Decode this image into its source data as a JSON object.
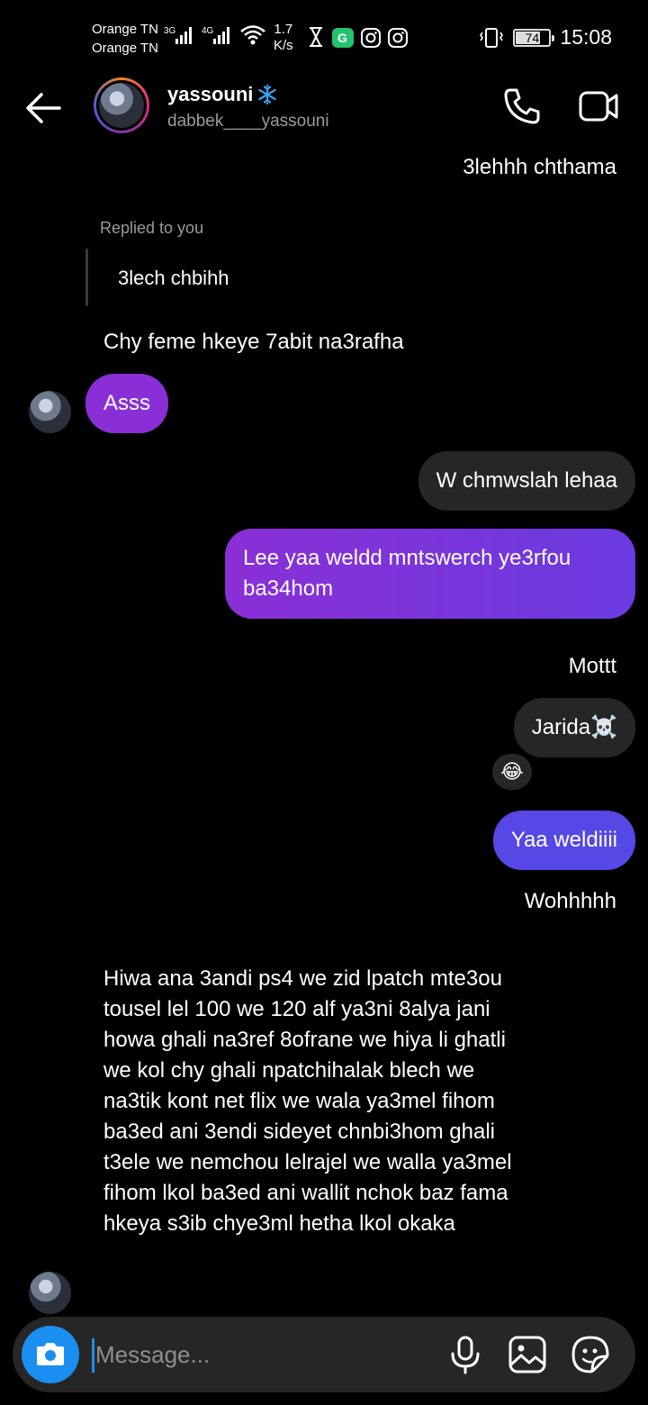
{
  "status_bar": {
    "carrier_1": "Orange TN",
    "carrier_2": "Orange TN",
    "net_1": "3G",
    "net_2": "4G",
    "speed_value": "1.7",
    "speed_unit": "K/s",
    "battery": "74",
    "battery_level": 0.74,
    "time": "15:08"
  },
  "header": {
    "name": "yassouni",
    "username": "dabbek____yassouni",
    "icons": [
      "back-arrow-icon",
      "verified-icon",
      "phone-icon",
      "video-camera-icon"
    ]
  },
  "messages": {
    "m1": "3lehhh chthama",
    "reply_label": "Replied to you",
    "reply_quote": "3lech chbihh",
    "m2": "Chy feme hkeye 7abit na3rafha",
    "m3": "Asss",
    "m4": "W chmwslah lehaa",
    "m5": "Lee yaa weldd mntswerch ye3rfou ba34hom",
    "m6": "Mottt",
    "m7": "Jarida☠️",
    "m7_reaction": "😂",
    "m8": "Yaa weldiiii",
    "m9": "Wohhhhh",
    "m10": "Hiwa ana 3andi ps4 we zid lpatch mte3ou tousel lel 100 we 120 alf ya3ni 8alya jani howa ghali na3ref 8ofrane we hiya li ghatli we kol chy ghali npatchihalak blech we na3tik kont net flix we wala ya3mel fihom ba3ed ani 3endi sideyet chnbi3hom ghali t3ele we nemchou lelrajel we walla ya3mel fihom lkol ba3ed ani wallit nchok baz fama hkeya s3ib chye3ml hetha lkol okaka"
  },
  "composer": {
    "placeholder": "Message...",
    "icons": [
      "camera-icon",
      "microphone-icon",
      "gallery-icon",
      "sticker-icon"
    ]
  },
  "colors": {
    "background": "#000000",
    "bubble_purple": "#8a2fd6",
    "bubble_gray": "#262626",
    "bubble_blue": "#5548e4",
    "accent_blue": "#1b8ff0"
  }
}
